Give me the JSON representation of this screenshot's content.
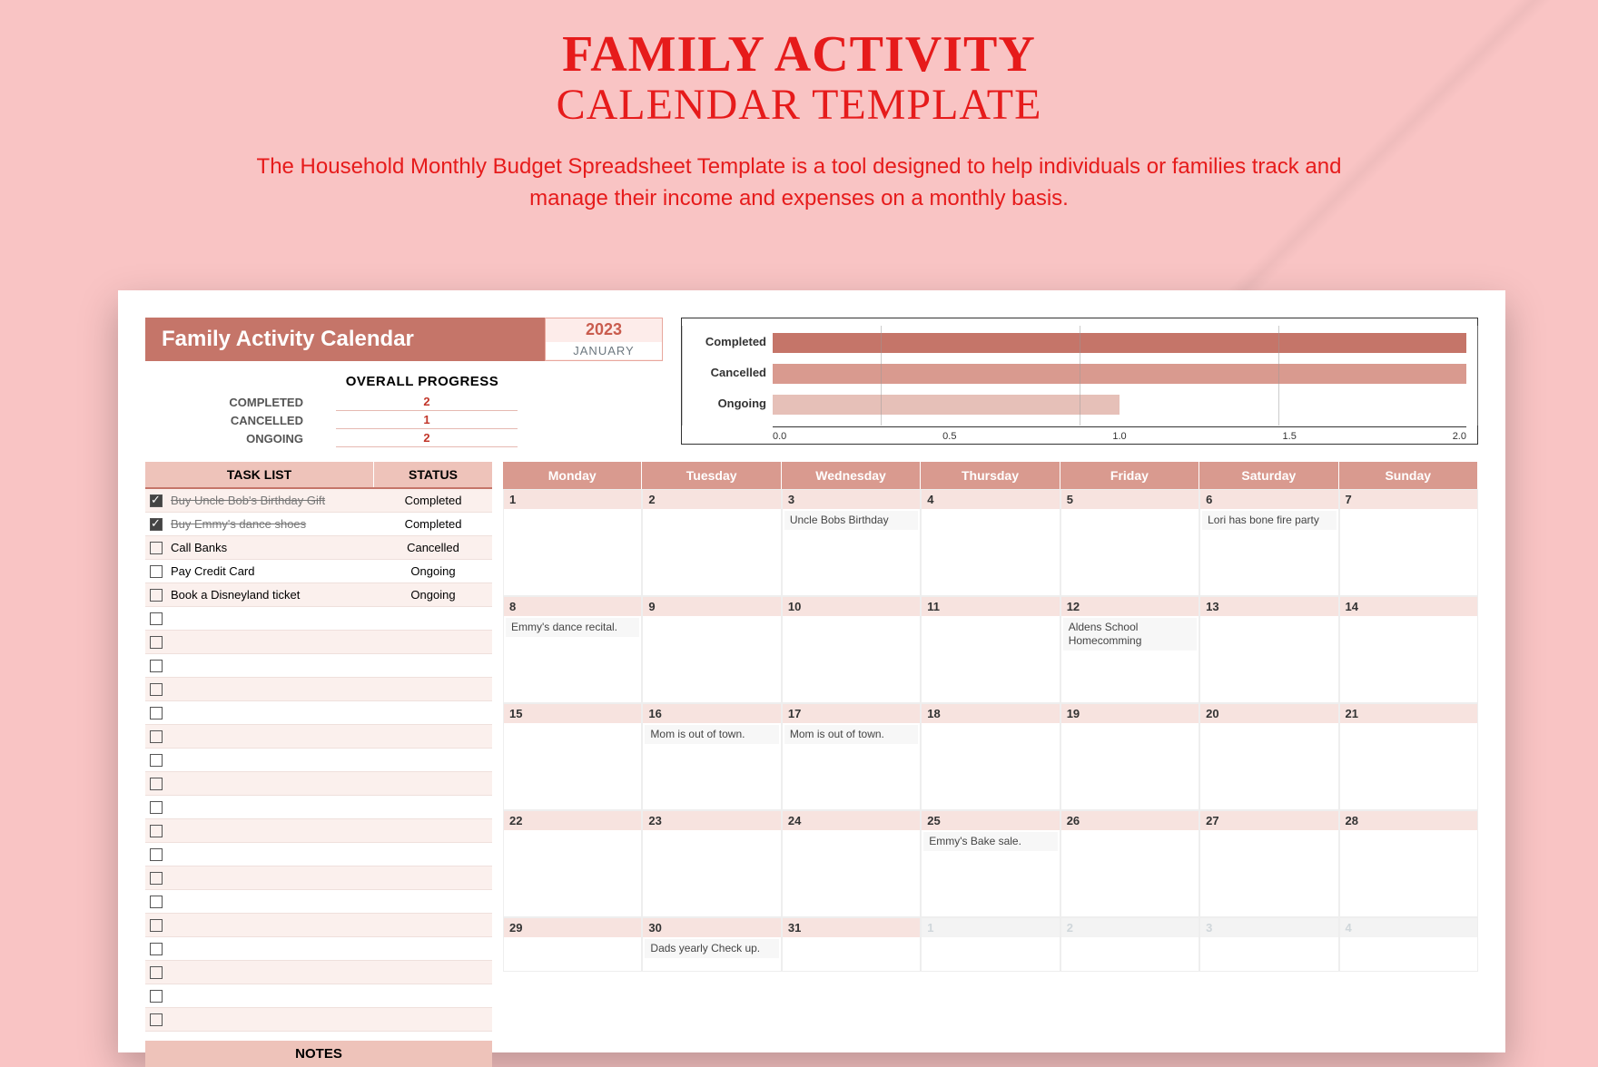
{
  "header": {
    "title_line1": "FAMILY ACTIVITY",
    "title_line2": "CALENDAR TEMPLATE",
    "subtitle": "The Household Monthly Budget Spreadsheet Template is a tool designed to help individuals or families track and manage their income and expenses on a monthly basis."
  },
  "sheet": {
    "title": "Family Activity Calendar",
    "year": "2023",
    "month": "JANUARY",
    "progress_head": "OVERALL PROGRESS",
    "progress": [
      {
        "label": "COMPLETED",
        "value": "2"
      },
      {
        "label": "CANCELLED",
        "value": "1"
      },
      {
        "label": "ONGOING",
        "value": "2"
      }
    ],
    "tasklist_head_a": "TASK LIST",
    "tasklist_head_b": "STATUS",
    "tasks": [
      {
        "done": true,
        "text": "Buy Uncle Bob's Birthday Gift",
        "status": "Completed",
        "strike": true
      },
      {
        "done": true,
        "text": "Buy Emmy's dance shoes",
        "status": "Completed",
        "strike": true
      },
      {
        "done": false,
        "text": "Call Banks",
        "status": "Cancelled",
        "strike": false
      },
      {
        "done": false,
        "text": "Pay Credit Card",
        "status": "Ongoing",
        "strike": false
      },
      {
        "done": false,
        "text": "Book a Disneyland ticket",
        "status": "Ongoing",
        "strike": false
      }
    ],
    "blank_tasks": 18,
    "notes_head": "NOTES",
    "days_head": [
      "Monday",
      "Tuesday",
      "Wednesday",
      "Thursday",
      "Friday",
      "Saturday",
      "Sunday"
    ],
    "weeks": [
      [
        {
          "n": "1",
          "ev": ""
        },
        {
          "n": "2",
          "ev": ""
        },
        {
          "n": "3",
          "ev": "Uncle Bobs Birthday"
        },
        {
          "n": "4",
          "ev": ""
        },
        {
          "n": "5",
          "ev": ""
        },
        {
          "n": "6",
          "ev": "Lori has bone fire party"
        },
        {
          "n": "7",
          "ev": ""
        }
      ],
      [
        {
          "n": "8",
          "ev": "Emmy's dance recital."
        },
        {
          "n": "9",
          "ev": ""
        },
        {
          "n": "10",
          "ev": ""
        },
        {
          "n": "11",
          "ev": ""
        },
        {
          "n": "12",
          "ev": "Aldens School Homecomming"
        },
        {
          "n": "13",
          "ev": ""
        },
        {
          "n": "14",
          "ev": ""
        }
      ],
      [
        {
          "n": "15",
          "ev": ""
        },
        {
          "n": "16",
          "ev": "Mom is out of town."
        },
        {
          "n": "17",
          "ev": "Mom is out of town."
        },
        {
          "n": "18",
          "ev": ""
        },
        {
          "n": "19",
          "ev": ""
        },
        {
          "n": "20",
          "ev": ""
        },
        {
          "n": "21",
          "ev": ""
        }
      ],
      [
        {
          "n": "22",
          "ev": ""
        },
        {
          "n": "23",
          "ev": ""
        },
        {
          "n": "24",
          "ev": ""
        },
        {
          "n": "25",
          "ev": "Emmy's Bake sale."
        },
        {
          "n": "26",
          "ev": ""
        },
        {
          "n": "27",
          "ev": ""
        },
        {
          "n": "28",
          "ev": ""
        }
      ],
      [
        {
          "n": "29",
          "ev": ""
        },
        {
          "n": "30",
          "ev": "Dads yearly Check up."
        },
        {
          "n": "31",
          "ev": ""
        },
        {
          "n": "1",
          "ev": "",
          "nm": true
        },
        {
          "n": "2",
          "ev": "",
          "nm": true
        },
        {
          "n": "3",
          "ev": "",
          "nm": true
        },
        {
          "n": "4",
          "ev": "",
          "nm": true
        }
      ]
    ]
  },
  "chart_data": {
    "type": "bar",
    "orientation": "horizontal",
    "categories": [
      "Completed",
      "Cancelled",
      "Ongoing"
    ],
    "values": [
      2,
      2,
      1
    ],
    "xlim": [
      0,
      2
    ],
    "ticks": [
      "0.0",
      "0.5",
      "1.0",
      "1.5",
      "2.0"
    ],
    "title": "",
    "xlabel": "",
    "ylabel": ""
  }
}
